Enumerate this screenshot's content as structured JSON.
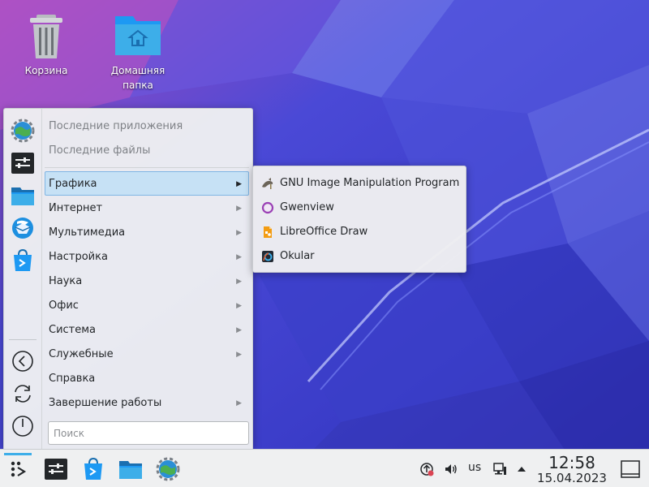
{
  "desktop": {
    "icons": [
      {
        "name": "trash",
        "label": "Корзина"
      },
      {
        "name": "home-folder",
        "label": "Домашняя папка"
      }
    ]
  },
  "start_menu": {
    "recent": [
      {
        "label": "Последние приложения"
      },
      {
        "label": "Последние файлы"
      }
    ],
    "categories": [
      {
        "label": "Графика",
        "has_submenu": true,
        "active": true
      },
      {
        "label": "Интернет",
        "has_submenu": true
      },
      {
        "label": "Мультимедиа",
        "has_submenu": true
      },
      {
        "label": "Настройка",
        "has_submenu": true
      },
      {
        "label": "Наука",
        "has_submenu": true
      },
      {
        "label": "Офис",
        "has_submenu": true
      },
      {
        "label": "Система",
        "has_submenu": true
      },
      {
        "label": "Служебные",
        "has_submenu": true
      },
      {
        "label": "Справка",
        "has_submenu": false
      },
      {
        "label": "Завершение работы",
        "has_submenu": true
      }
    ],
    "arrow_glyph": "▶",
    "search": {
      "placeholder": "Поиск"
    },
    "favorites": [
      "system-settings-icon",
      "konsole-icon",
      "dolphin-icon",
      "thunderbird-icon",
      "discover-icon"
    ],
    "actions": [
      "logout-icon",
      "restart-icon",
      "shutdown-icon"
    ]
  },
  "submenu": {
    "items": [
      {
        "label": "GNU Image Manipulation Program",
        "icon": "gimp-icon"
      },
      {
        "label": "Gwenview",
        "icon": "gwenview-icon"
      },
      {
        "label": "LibreOffice Draw",
        "icon": "libreoffice-draw-icon"
      },
      {
        "label": "Okular",
        "icon": "okular-icon"
      }
    ]
  },
  "taskbar": {
    "tasks": [
      "konsole-icon",
      "discover-icon",
      "dolphin-icon",
      "system-settings-icon"
    ],
    "tray": {
      "keyboard_layout": "us",
      "time": "12:58",
      "date": "15.04.2023"
    }
  },
  "colors": {
    "accent": "#3daee9",
    "selection": "#c6e1f5",
    "panel": "#eff0f1",
    "text": "#232629"
  }
}
